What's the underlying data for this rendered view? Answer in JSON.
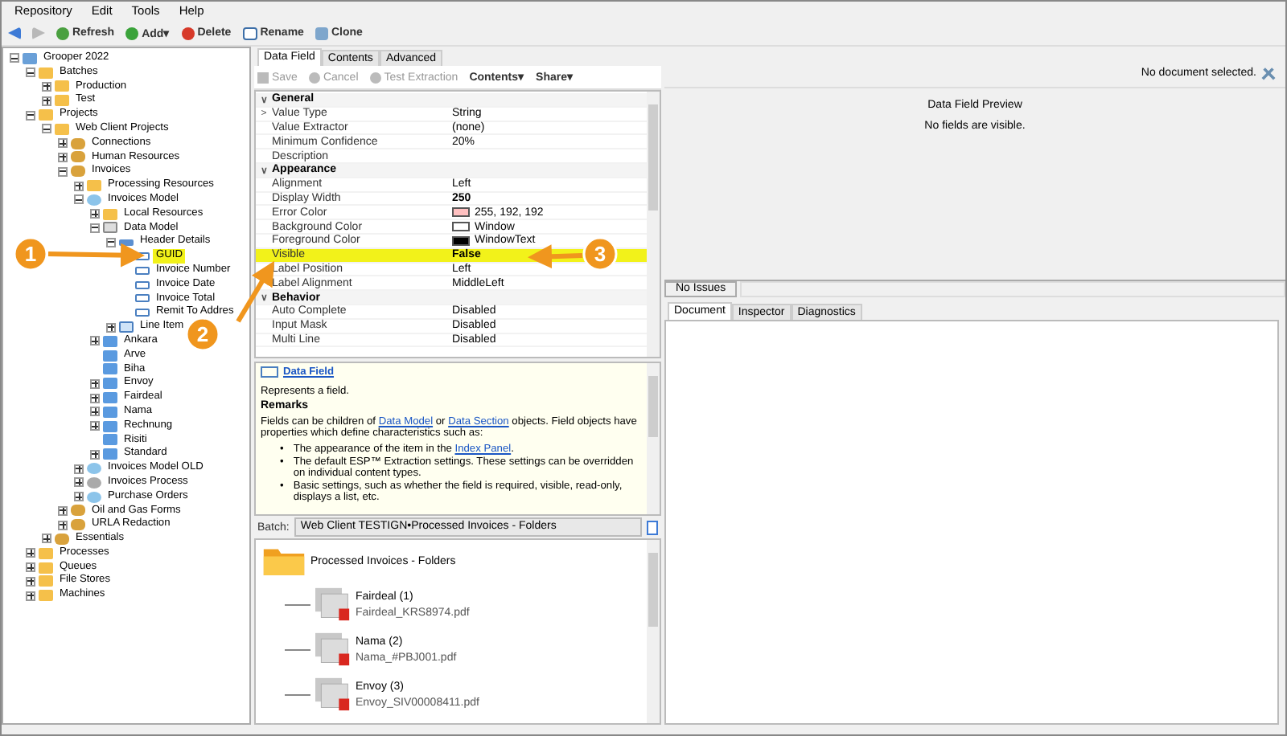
{
  "menu": [
    "Repository",
    "Edit",
    "Tools",
    "Help"
  ],
  "toolbar": [
    {
      "kind": "back"
    },
    {
      "kind": "forward"
    },
    {
      "kind": "refresh",
      "label": "Refresh"
    },
    {
      "kind": "add",
      "label": "Add",
      "caret": "▾"
    },
    {
      "kind": "delete",
      "label": "Delete"
    },
    {
      "kind": "rename",
      "label": "Rename"
    },
    {
      "kind": "clone",
      "label": "Clone"
    }
  ],
  "tree": [
    {
      "label": "Grooper 2022",
      "kind": "server",
      "expanded": true,
      "selected": false,
      "children": [
        {
          "label": "Batches",
          "kind": "folder",
          "expanded": true,
          "selected": false,
          "children": [
            {
              "label": "Production",
              "kind": "folder",
              "expanded": false,
              "selected": false
            },
            {
              "label": "Test",
              "kind": "folder",
              "expanded": false,
              "selected": false
            }
          ]
        },
        {
          "label": "Projects",
          "kind": "folder",
          "expanded": true,
          "selected": false,
          "children": [
            {
              "label": "Web Client Projects",
              "kind": "folder",
              "expanded": true,
              "selected": false,
              "children": [
                {
                  "label": "Connections",
                  "kind": "project",
                  "expanded": false,
                  "selected": false
                },
                {
                  "label": "Human Resources",
                  "kind": "project",
                  "expanded": false,
                  "selected": false
                },
                {
                  "label": "Invoices",
                  "kind": "project",
                  "expanded": true,
                  "selected": false,
                  "children": [
                    {
                      "label": "Processing Resources",
                      "kind": "folder",
                      "expanded": false,
                      "selected": false
                    },
                    {
                      "label": "Invoices Model",
                      "kind": "model",
                      "expanded": true,
                      "selected": false,
                      "children": [
                        {
                          "label": "Local Resources",
                          "kind": "folder",
                          "expanded": false,
                          "selected": false
                        },
                        {
                          "label": "Data Model",
                          "kind": "datamodel",
                          "expanded": true,
                          "selected": false,
                          "children": [
                            {
                              "label": "Header Details",
                              "kind": "section",
                              "expanded": true,
                              "selected": false,
                              "children": [
                                {
                                  "label": "GUID",
                                  "kind": "field",
                                  "selected": true
                                },
                                {
                                  "label": "Invoice Number",
                                  "kind": "field",
                                  "selected": false
                                },
                                {
                                  "label": "Invoice Date",
                                  "kind": "field",
                                  "selected": false
                                },
                                {
                                  "label": "Invoice Total",
                                  "kind": "field",
                                  "selected": false
                                },
                                {
                                  "label": "Remit To Addres",
                                  "kind": "field",
                                  "selected": false
                                }
                              ]
                            },
                            {
                              "label": "Line Item",
                              "kind": "table",
                              "expanded": false,
                              "selected": false
                            }
                          ]
                        },
                        {
                          "label": "Ankara",
                          "kind": "doctype",
                          "expanded": false,
                          "selected": false
                        },
                        {
                          "label": "Arve",
                          "kind": "doctype",
                          "selected": false
                        },
                        {
                          "label": "Biha",
                          "kind": "doctype",
                          "selected": false
                        },
                        {
                          "label": "Envoy",
                          "kind": "doctype",
                          "expanded": false,
                          "selected": false
                        },
                        {
                          "label": "Fairdeal",
                          "kind": "doctype",
                          "expanded": false,
                          "selected": false
                        },
                        {
                          "label": "Nama",
                          "kind": "doctype",
                          "expanded": false,
                          "selected": false
                        },
                        {
                          "label": "Rechnung",
                          "kind": "doctype",
                          "expanded": false,
                          "selected": false
                        },
                        {
                          "label": "Risiti",
                          "kind": "doctype",
                          "selected": false
                        },
                        {
                          "label": "Standard",
                          "kind": "doctype",
                          "expanded": false,
                          "selected": false
                        }
                      ]
                    },
                    {
                      "label": "Invoices Model OLD",
                      "kind": "model",
                      "expanded": false,
                      "selected": false
                    },
                    {
                      "label": "Invoices Process",
                      "kind": "gear",
                      "expanded": false,
                      "selected": false
                    },
                    {
                      "label": "Purchase Orders",
                      "kind": "model",
                      "expanded": false,
                      "selected": false
                    }
                  ]
                },
                {
                  "label": "Oil and Gas Forms",
                  "kind": "project",
                  "expanded": false,
                  "selected": false
                },
                {
                  "label": "URLA Redaction",
                  "kind": "project",
                  "expanded": false,
                  "selected": false
                }
              ]
            },
            {
              "label": "Essentials",
              "kind": "project",
              "expanded": false,
              "selected": false
            }
          ]
        },
        {
          "label": "Processes",
          "kind": "folder",
          "expanded": false,
          "selected": false
        },
        {
          "label": "Queues",
          "kind": "folder",
          "expanded": false,
          "selected": false
        },
        {
          "label": "File Stores",
          "kind": "folder",
          "expanded": false,
          "selected": false
        },
        {
          "label": "Machines",
          "kind": "folder",
          "expanded": false,
          "selected": false
        }
      ]
    }
  ],
  "editor_tabs": [
    {
      "label": "Data Field",
      "selected": true
    },
    {
      "label": "Contents",
      "selected": false
    },
    {
      "label": "Advanced",
      "selected": false
    }
  ],
  "editor_toolbar": [
    {
      "kind": "save",
      "label": "Save",
      "disabled": true
    },
    {
      "kind": "cancel",
      "label": "Cancel",
      "disabled": true
    },
    {
      "kind": "test",
      "label": "Test Extraction",
      "disabled": true
    },
    {
      "kind": "menu",
      "label": "Contents",
      "caret": "▾",
      "disabled": false
    },
    {
      "kind": "menu",
      "label": "Share",
      "caret": "▾",
      "disabled": false
    }
  ],
  "properties": [
    {
      "kind": "category",
      "name": "General",
      "chevron": "∨"
    },
    {
      "kind": "property",
      "name": "Value Type",
      "value": "String",
      "expander": ">"
    },
    {
      "kind": "property",
      "name": "Value Extractor",
      "value": "(none)"
    },
    {
      "kind": "property",
      "name": "Minimum Confidence",
      "value": "20%"
    },
    {
      "kind": "property",
      "name": "Description"
    },
    {
      "kind": "category",
      "name": "Appearance",
      "chevron": "∨"
    },
    {
      "kind": "property",
      "name": "Alignment",
      "value": "Left"
    },
    {
      "kind": "property",
      "name": "Display Width",
      "value": "250",
      "bold": true
    },
    {
      "kind": "property",
      "name": "Error Color",
      "value": "255, 192, 192",
      "color": "#ffc0c0"
    },
    {
      "kind": "property",
      "name": "Background Color",
      "value": "Window",
      "color": "#ffffff"
    },
    {
      "kind": "property",
      "name": "Foreground Color",
      "value": "WindowText",
      "color": "#000000"
    },
    {
      "kind": "property",
      "name": "Visible",
      "value": "False",
      "bold": true,
      "highlighted": true
    },
    {
      "kind": "property",
      "name": "Label Position",
      "value": "Left"
    },
    {
      "kind": "property",
      "name": "Label Alignment",
      "value": "MiddleLeft"
    },
    {
      "kind": "category",
      "name": "Behavior",
      "chevron": "∨"
    },
    {
      "kind": "property",
      "name": "Auto Complete",
      "value": "Disabled"
    },
    {
      "kind": "property",
      "name": "Input Mask",
      "value": "Disabled"
    },
    {
      "kind": "property",
      "name": "Multi Line",
      "value": "Disabled"
    }
  ],
  "help": {
    "title": "Data Field",
    "summary": "Represents a field.",
    "heading": "Remarks",
    "paragraph": [
      {
        "text": "Fields can be children of "
      },
      {
        "text": "Data Model",
        "link": true
      },
      {
        "text": " or "
      },
      {
        "text": "Data Section",
        "link": true
      },
      {
        "text": " objects. Field objects have properties which define characteristics such as:"
      }
    ],
    "bullet": "•",
    "bullets": [
      [
        {
          "text": "The appearance of the item in the "
        },
        {
          "text": "Index Panel",
          "link": true
        },
        {
          "text": "."
        }
      ],
      [
        {
          "text": "The default ESP™ Extraction settings. These settings can be overridden on individual content types."
        }
      ],
      [
        {
          "text": "Basic settings, such as whether the field is required, visible, read-only, displays a list, etc."
        }
      ]
    ]
  },
  "batch": {
    "label": "Batch:",
    "value": "Web Client TESTIGN•Processed Invoices - Folders",
    "root": "Processed Invoices - Folders",
    "folders": [
      {
        "name": "Fairdeal (1)",
        "file": "Fairdeal_KRS8974.pdf"
      },
      {
        "name": "Nama (2)",
        "file": "Nama_#PBJ001.pdf"
      },
      {
        "name": "Envoy (3)",
        "file": "Envoy_SIV00008411.pdf"
      }
    ]
  },
  "preview": {
    "status": "No document selected.",
    "title": "Data Field Preview",
    "message": "No fields are visible.",
    "issues": "No Issues"
  },
  "viewer_tabs": [
    {
      "label": "Document",
      "selected": true
    },
    {
      "label": "Inspector",
      "selected": false
    },
    {
      "label": "Diagnostics",
      "selected": false
    }
  ],
  "callouts": [
    "1",
    "2",
    "3"
  ]
}
